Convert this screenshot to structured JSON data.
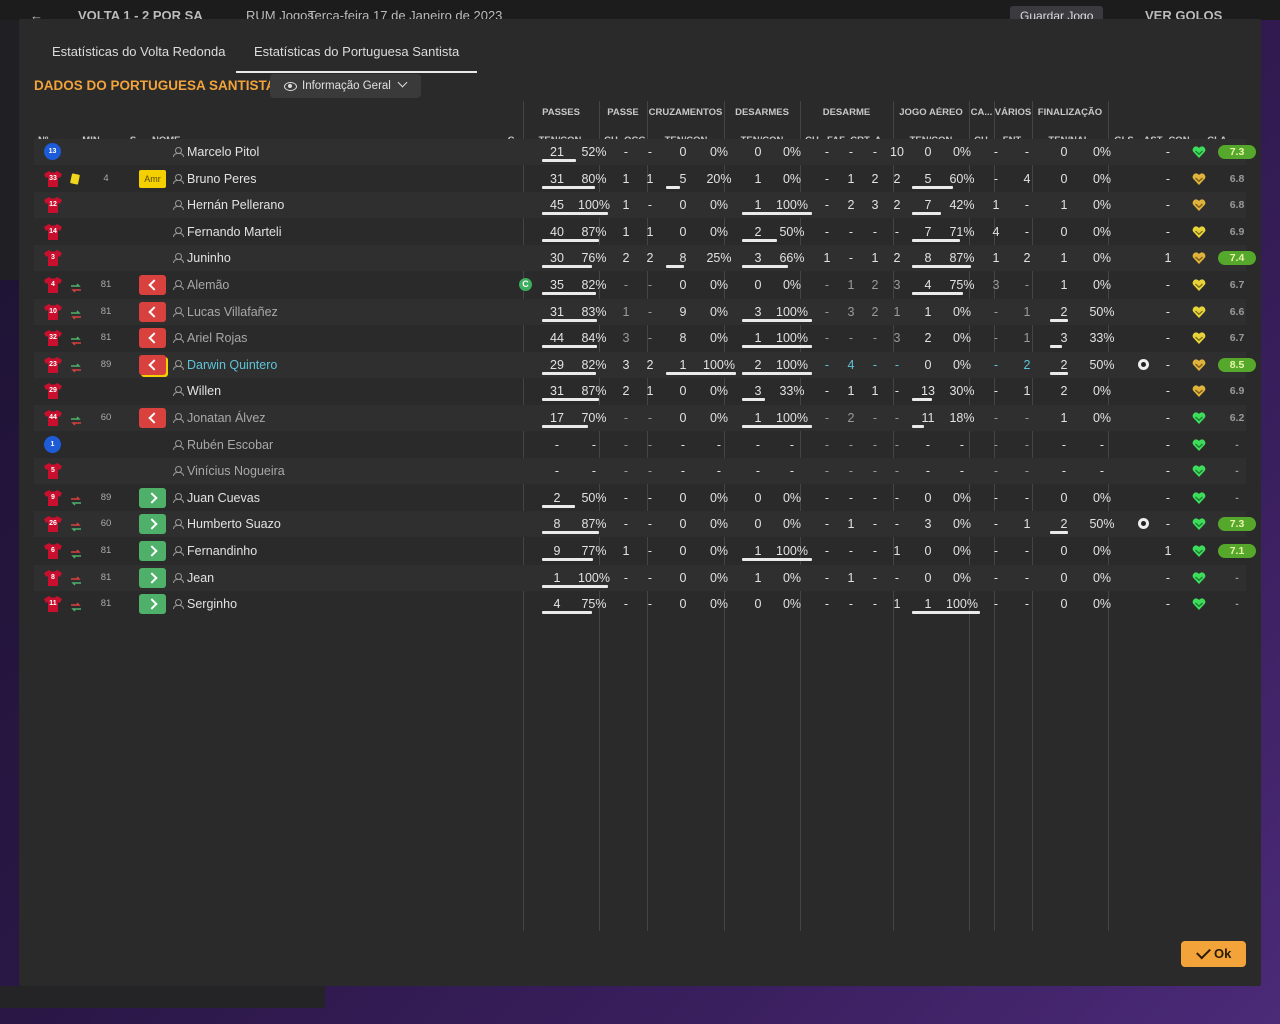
{
  "background": {
    "score_text": "VOLTA   1 - 2   POR SA",
    "competition": "RUM Jogos",
    "date": "Terça-feira 17 de Janeiro de 2023",
    "save_label": "Guardar Jogo",
    "goals_label": "VER GOLOS"
  },
  "tabs": [
    {
      "label": "Estatísticas do Volta Redonda"
    },
    {
      "label": "Estatísticas do Portuguesa Santista"
    }
  ],
  "team_title": "DADOS DO PORTUGUESA SANTISTA",
  "view_dropdown": {
    "label": "Informação Geral"
  },
  "groups": [
    "PASSES",
    "PASSE",
    "CRUZAMENTOS",
    "DESARMES",
    "DESARME",
    "JOGO AÉREO",
    "CA...",
    "VÁRIOS",
    "FINALIZAÇÃO"
  ],
  "columns": [
    "Nº",
    "MIN",
    "S",
    "NOME",
    "C",
    "TEN/CON",
    "CH",
    "OCG",
    "TEN/CON",
    "TEN/CON",
    "CH",
    "FAF",
    "CRT",
    "A...",
    "TEN/CON",
    "CH",
    "FNT",
    "TEN/NAL",
    "GLS",
    "AST",
    "CON",
    "CLA"
  ],
  "colors": {
    "accent": "#f2a33a",
    "sub_off": "#d9413e",
    "sub_on": "#4fb06a",
    "yellow_card": "#f5d000",
    "rating_green": "#55a82b",
    "form_green": "#3ddc5a",
    "form_gold": "#e0b33a"
  },
  "rows": [
    {
      "num": "13",
      "gk": true,
      "min": "",
      "status": "",
      "name": "Marcelo Pitol",
      "captain": false,
      "pas_t": "21",
      "pas_p": "52%",
      "pas_f": 0.52,
      "ch": "-",
      "ocg": "-",
      "cru_t": "0",
      "cru_p": "0%",
      "cru_f": 0,
      "des_t": "0",
      "des_p": "0%",
      "des_f": 0,
      "d_ch": "-",
      "faf": "-",
      "crt": "-",
      "a": "10",
      "aer_t": "0",
      "aer_p": "0%",
      "aer_f": 0,
      "ca": "-",
      "fnt": "-",
      "fin_t": "0",
      "fin_p": "0%",
      "fin_f": 0,
      "gls": "",
      "ast": "-",
      "con": "green",
      "cla": "7.3",
      "cla_hi": true
    },
    {
      "num": "33",
      "gk": false,
      "min": "4",
      "card": true,
      "status": "Amr",
      "name": "Bruno Peres",
      "captain": false,
      "pas_t": "31",
      "pas_p": "80%",
      "pas_f": 0.8,
      "ch": "1",
      "ocg": "1",
      "cru_t": "5",
      "cru_p": "20%",
      "cru_f": 0.2,
      "des_t": "1",
      "des_p": "0%",
      "des_f": 0,
      "d_ch": "-",
      "faf": "1",
      "crt": "2",
      "a": "2",
      "aer_t": "5",
      "aer_p": "60%",
      "aer_f": 0.6,
      "ca": "-",
      "fnt": "4",
      "fin_t": "0",
      "fin_p": "0%",
      "fin_f": 0,
      "gls": "",
      "ast": "-",
      "con": "gold",
      "cla": "6.8",
      "cla_hi": false
    },
    {
      "num": "12",
      "gk": false,
      "min": "",
      "status": "",
      "name": "Hernán Pellerano",
      "captain": false,
      "pas_t": "45",
      "pas_p": "100%",
      "pas_f": 1.0,
      "ch": "1",
      "ocg": "-",
      "cru_t": "0",
      "cru_p": "0%",
      "cru_f": 0,
      "des_t": "1",
      "des_p": "100%",
      "des_f": 1.0,
      "d_ch": "-",
      "faf": "2",
      "crt": "3",
      "a": "2",
      "aer_t": "7",
      "aer_p": "42%",
      "aer_f": 0.42,
      "ca": "1",
      "fnt": "-",
      "fin_t": "1",
      "fin_p": "0%",
      "fin_f": 0,
      "gls": "",
      "ast": "-",
      "con": "gold",
      "cla": "6.8",
      "cla_hi": false
    },
    {
      "num": "14",
      "gk": false,
      "min": "",
      "status": "",
      "name": "Fernando Marteli",
      "captain": false,
      "pas_t": "40",
      "pas_p": "87%",
      "pas_f": 0.87,
      "ch": "1",
      "ocg": "1",
      "cru_t": "0",
      "cru_p": "0%",
      "cru_f": 0,
      "des_t": "2",
      "des_p": "50%",
      "des_f": 0.5,
      "d_ch": "-",
      "faf": "-",
      "crt": "-",
      "a": "-",
      "aer_t": "7",
      "aer_p": "71%",
      "aer_f": 0.71,
      "ca": "4",
      "fnt": "-",
      "fin_t": "0",
      "fin_p": "0%",
      "fin_f": 0,
      "gls": "",
      "ast": "-",
      "con": "yellow",
      "cla": "6.9",
      "cla_hi": false
    },
    {
      "num": "3",
      "gk": false,
      "min": "",
      "status": "",
      "name": "Juninho",
      "captain": false,
      "pas_t": "30",
      "pas_p": "76%",
      "pas_f": 0.76,
      "ch": "2",
      "ocg": "2",
      "cru_t": "8",
      "cru_p": "25%",
      "cru_f": 0.25,
      "des_t": "3",
      "des_p": "66%",
      "des_f": 0.66,
      "d_ch": "1",
      "faf": "-",
      "crt": "1",
      "a": "2",
      "aer_t": "8",
      "aer_p": "87%",
      "aer_f": 0.87,
      "ca": "1",
      "fnt": "2",
      "fin_t": "1",
      "fin_p": "0%",
      "fin_f": 0,
      "gls": "",
      "ast": "1",
      "con": "gold",
      "cla": "7.4",
      "cla_hi": true
    },
    {
      "num": "4",
      "gk": false,
      "min": "81",
      "sub": "off",
      "status": "out",
      "name": "Alemão",
      "captain": true,
      "dim": true,
      "pas_t": "35",
      "pas_p": "82%",
      "pas_f": 0.82,
      "ch": "-",
      "ocg": "-",
      "cru_t": "0",
      "cru_p": "0%",
      "cru_f": 0,
      "des_t": "0",
      "des_p": "0%",
      "des_f": 0,
      "d_ch": "-",
      "faf": "1",
      "crt": "2",
      "a": "3",
      "aer_t": "4",
      "aer_p": "75%",
      "aer_f": 0.75,
      "ca": "3",
      "fnt": "-",
      "fin_t": "1",
      "fin_p": "0%",
      "fin_f": 0,
      "gls": "",
      "ast": "-",
      "con": "yellow",
      "cla": "6.7",
      "cla_hi": false
    },
    {
      "num": "10",
      "gk": false,
      "min": "81",
      "sub": "off",
      "status": "out",
      "name": "Lucas Villafañez",
      "captain": false,
      "dim": true,
      "pas_t": "31",
      "pas_p": "83%",
      "pas_f": 0.83,
      "ch": "1",
      "ocg": "-",
      "cru_t": "9",
      "cru_p": "0%",
      "cru_f": 0,
      "des_t": "3",
      "des_p": "100%",
      "des_f": 1.0,
      "d_ch": "-",
      "faf": "3",
      "crt": "2",
      "a": "1",
      "aer_t": "1",
      "aer_p": "0%",
      "aer_f": 0,
      "ca": "-",
      "fnt": "1",
      "fin_t": "2",
      "fin_p": "50%",
      "fin_f": 0.5,
      "gls": "",
      "ast": "-",
      "con": "yellow",
      "cla": "6.6",
      "cla_hi": false
    },
    {
      "num": "32",
      "gk": false,
      "min": "81",
      "sub": "off",
      "status": "out",
      "name": "Ariel Rojas",
      "captain": false,
      "dim": true,
      "pas_t": "44",
      "pas_p": "84%",
      "pas_f": 0.84,
      "ch": "3",
      "ocg": "-",
      "cru_t": "8",
      "cru_p": "0%",
      "cru_f": 0,
      "des_t": "1",
      "des_p": "100%",
      "des_f": 1.0,
      "d_ch": "-",
      "faf": "-",
      "crt": "-",
      "a": "3",
      "aer_t": "2",
      "aer_p": "0%",
      "aer_f": 0,
      "ca": "-",
      "fnt": "1",
      "fin_t": "3",
      "fin_p": "33%",
      "fin_f": 0.33,
      "gls": "",
      "ast": "-",
      "con": "yellow",
      "cla": "6.7",
      "cla_hi": false
    },
    {
      "num": "23",
      "gk": false,
      "min": "89",
      "sub": "off",
      "status": "out",
      "status_y": true,
      "name": "Darwin Quintero",
      "captain": false,
      "cyan": true,
      "pas_t": "29",
      "pas_p": "82%",
      "pas_f": 0.82,
      "ch": "3",
      "ocg": "2",
      "cru_t": "1",
      "cru_p": "100%",
      "cru_f": 1.0,
      "des_t": "2",
      "des_p": "100%",
      "des_f": 1.0,
      "d_ch": "-",
      "faf": "4",
      "crt": "-",
      "a": "-",
      "aer_t": "0",
      "aer_p": "0%",
      "aer_f": 0,
      "ca": "-",
      "fnt": "2",
      "fin_t": "2",
      "fin_p": "50%",
      "fin_f": 0.5,
      "gls": "ball",
      "ast": "-",
      "con": "gold",
      "cla": "8.5",
      "cla_hi": true
    },
    {
      "num": "29",
      "gk": false,
      "min": "",
      "status": "",
      "name": "Willen",
      "captain": false,
      "pas_t": "31",
      "pas_p": "87%",
      "pas_f": 0.87,
      "ch": "2",
      "ocg": "1",
      "cru_t": "0",
      "cru_p": "0%",
      "cru_f": 0,
      "des_t": "3",
      "des_p": "33%",
      "des_f": 0.33,
      "d_ch": "-",
      "faf": "1",
      "crt": "1",
      "a": "-",
      "aer_t": "13",
      "aer_p": "30%",
      "aer_f": 0.3,
      "ca": "-",
      "fnt": "1",
      "fin_t": "2",
      "fin_p": "0%",
      "fin_f": 0,
      "gls": "",
      "ast": "-",
      "con": "gold",
      "cla": "6.9",
      "cla_hi": false
    },
    {
      "num": "44",
      "gk": false,
      "min": "60",
      "sub": "off",
      "status": "out",
      "name": "Jonatan Álvez",
      "captain": false,
      "dim": true,
      "pas_t": "17",
      "pas_p": "70%",
      "pas_f": 0.7,
      "ch": "-",
      "ocg": "-",
      "cru_t": "0",
      "cru_p": "0%",
      "cru_f": 0,
      "des_t": "1",
      "des_p": "100%",
      "des_f": 1.0,
      "d_ch": "-",
      "faf": "2",
      "crt": "-",
      "a": "-",
      "aer_t": "11",
      "aer_p": "18%",
      "aer_f": 0.18,
      "ca": "-",
      "fnt": "-",
      "fin_t": "1",
      "fin_p": "0%",
      "fin_f": 0,
      "gls": "",
      "ast": "-",
      "con": "green",
      "cla": "6.2",
      "cla_hi": false
    },
    {
      "num": "1",
      "gk": true,
      "min": "",
      "status": "",
      "name": "Rubén Escobar",
      "captain": false,
      "dim": true,
      "pas_t": "-",
      "pas_p": "-",
      "pas_f": 0,
      "ch": "-",
      "ocg": "-",
      "cru_t": "-",
      "cru_p": "-",
      "cru_f": 0,
      "des_t": "-",
      "des_p": "-",
      "des_f": 0,
      "d_ch": "-",
      "faf": "-",
      "crt": "-",
      "a": "-",
      "aer_t": "-",
      "aer_p": "-",
      "aer_f": 0,
      "ca": "-",
      "fnt": "-",
      "fin_t": "-",
      "fin_p": "-",
      "fin_f": 0,
      "gls": "",
      "ast": "-",
      "con": "green",
      "cla": "-",
      "cla_hi": false
    },
    {
      "num": "5",
      "gk": false,
      "min": "",
      "status": "",
      "name": "Vinícius Nogueira",
      "captain": false,
      "dim": true,
      "pas_t": "-",
      "pas_p": "-",
      "pas_f": 0,
      "ch": "-",
      "ocg": "-",
      "cru_t": "-",
      "cru_p": "-",
      "cru_f": 0,
      "des_t": "-",
      "des_p": "-",
      "des_f": 0,
      "d_ch": "-",
      "faf": "-",
      "crt": "-",
      "a": "-",
      "aer_t": "-",
      "aer_p": "-",
      "aer_f": 0,
      "ca": "-",
      "fnt": "-",
      "fin_t": "-",
      "fin_p": "-",
      "fin_f": 0,
      "gls": "",
      "ast": "-",
      "con": "green",
      "cla": "-",
      "cla_hi": false
    },
    {
      "num": "9",
      "gk": false,
      "min": "89",
      "sub": "on",
      "status": "in",
      "name": "Juan Cuevas",
      "captain": false,
      "pas_t": "2",
      "pas_p": "50%",
      "pas_f": 0.5,
      "ch": "-",
      "ocg": "-",
      "cru_t": "0",
      "cru_p": "0%",
      "cru_f": 0,
      "des_t": "0",
      "des_p": "0%",
      "des_f": 0,
      "d_ch": "-",
      "faf": "-",
      "crt": "-",
      "a": "-",
      "aer_t": "0",
      "aer_p": "0%",
      "aer_f": 0,
      "ca": "-",
      "fnt": "-",
      "fin_t": "0",
      "fin_p": "0%",
      "fin_f": 0,
      "gls": "",
      "ast": "-",
      "con": "green",
      "cla": "-",
      "cla_hi": false
    },
    {
      "num": "26",
      "gk": false,
      "min": "60",
      "sub": "on",
      "status": "in",
      "name": "Humberto Suazo",
      "captain": false,
      "pas_t": "8",
      "pas_p": "87%",
      "pas_f": 0.87,
      "ch": "-",
      "ocg": "-",
      "cru_t": "0",
      "cru_p": "0%",
      "cru_f": 0,
      "des_t": "0",
      "des_p": "0%",
      "des_f": 0,
      "d_ch": "-",
      "faf": "1",
      "crt": "-",
      "a": "-",
      "aer_t": "3",
      "aer_p": "0%",
      "aer_f": 0,
      "ca": "-",
      "fnt": "1",
      "fin_t": "2",
      "fin_p": "50%",
      "fin_f": 0.5,
      "gls": "ball",
      "ast": "-",
      "con": "green",
      "cla": "7.3",
      "cla_hi": true
    },
    {
      "num": "6",
      "gk": false,
      "min": "81",
      "sub": "on",
      "status": "in",
      "name": "Fernandinho",
      "captain": false,
      "pas_t": "9",
      "pas_p": "77%",
      "pas_f": 0.77,
      "ch": "1",
      "ocg": "-",
      "cru_t": "0",
      "cru_p": "0%",
      "cru_f": 0,
      "des_t": "1",
      "des_p": "100%",
      "des_f": 1.0,
      "d_ch": "-",
      "faf": "-",
      "crt": "-",
      "a": "1",
      "aer_t": "0",
      "aer_p": "0%",
      "aer_f": 0,
      "ca": "-",
      "fnt": "-",
      "fin_t": "0",
      "fin_p": "0%",
      "fin_f": 0,
      "gls": "",
      "ast": "1",
      "con": "green",
      "cla": "7.1",
      "cla_hi": true
    },
    {
      "num": "8",
      "gk": false,
      "min": "81",
      "sub": "on",
      "status": "in",
      "name": "Jean",
      "captain": false,
      "pas_t": "1",
      "pas_p": "100%",
      "pas_f": 1.0,
      "ch": "-",
      "ocg": "-",
      "cru_t": "0",
      "cru_p": "0%",
      "cru_f": 0,
      "des_t": "1",
      "des_p": "0%",
      "des_f": 0,
      "d_ch": "-",
      "faf": "1",
      "crt": "-",
      "a": "-",
      "aer_t": "0",
      "aer_p": "0%",
      "aer_f": 0,
      "ca": "-",
      "fnt": "-",
      "fin_t": "0",
      "fin_p": "0%",
      "fin_f": 0,
      "gls": "",
      "ast": "-",
      "con": "green",
      "cla": "-",
      "cla_hi": false
    },
    {
      "num": "11",
      "gk": false,
      "min": "81",
      "sub": "on",
      "status": "in",
      "name": "Serginho",
      "captain": false,
      "pas_t": "4",
      "pas_p": "75%",
      "pas_f": 0.75,
      "ch": "-",
      "ocg": "-",
      "cru_t": "0",
      "cru_p": "0%",
      "cru_f": 0,
      "des_t": "0",
      "des_p": "0%",
      "des_f": 0,
      "d_ch": "-",
      "faf": "-",
      "crt": "-",
      "a": "1",
      "aer_t": "1",
      "aer_p": "100%",
      "aer_f": 1.0,
      "ca": "-",
      "fnt": "-",
      "fin_t": "0",
      "fin_p": "0%",
      "fin_f": 0,
      "gls": "",
      "ast": "-",
      "con": "green",
      "cla": "-",
      "cla_hi": false
    }
  ],
  "ok_label": "Ok"
}
